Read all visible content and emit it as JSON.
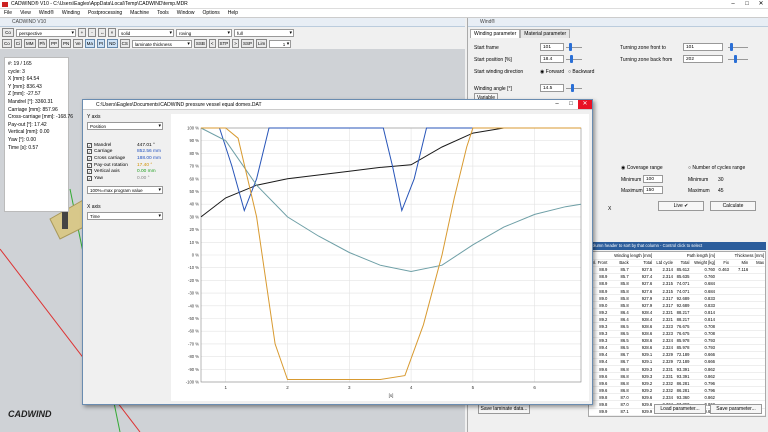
{
  "app": {
    "title": "CADWIND® V10  -  C:\\Users\\Eagles\\AppData\\Local\\Temp\\CADWIND\\temp.MDR"
  },
  "menu": [
    "File",
    "View",
    "Wind®",
    "Winding",
    "Postprocessing",
    "Machine",
    "Tools",
    "Window",
    "Options",
    "Help"
  ],
  "view3d": {
    "title": "CADWIND V10",
    "perspective": "perspective",
    "buttons1": [
      "Co",
      "Ci",
      "MM",
      "Ph",
      "PP",
      "PN",
      "Ve",
      "Ma",
      "PI",
      "ND",
      "CS"
    ],
    "solid": "solid",
    "roving": "roving",
    "full": "full",
    "laminate": "laminate thickness",
    "ssb": "SSB",
    "stp": "STP",
    "ssp": "SSP",
    "lim": "Lim",
    "value": "1"
  },
  "info": [
    "#: 19 / 165",
    "cycle: 3",
    "X [mm]: 64.54",
    "Y [mm]: 836.43",
    "Z [mm]: -27.57",
    "Mandrel [°]: 3360.31",
    "Carriage [mm]: 857.96",
    "Cross-carriage [mm]: -168.76",
    "Pay-out [°]: 17.42",
    "Vertical [mm]: 0.00",
    "Yaw [°]: 0.00",
    "Time [s]: 0.57"
  ],
  "dialog": {
    "title": "C:\\Users\\Eagles\\Documents\\CADWIND pressure vessel equal domes.DAT",
    "y_axis_label": "Y axis",
    "y_axis_select": "Position",
    "checks": [
      {
        "name": "Mandrel",
        "value": "447.01 °",
        "color": "#000000"
      },
      {
        "name": "Carriage",
        "value": "852.56 mm",
        "color": "#1f4fbf"
      },
      {
        "name": "Cross carriage",
        "value": "188.00 mm",
        "color": "#1f4fbf"
      },
      {
        "name": "Pay-out rotation",
        "value": "17.40 °",
        "color": "#d09000"
      },
      {
        "name": "Vertical axis",
        "value": "0.00 mm",
        "color": "#20a020"
      },
      {
        "name": "Yaw",
        "value": "0.00 °",
        "color": "#888888"
      }
    ],
    "range_select": "100%=max program value",
    "x_axis_label": "X axis",
    "x_axis_select": "Time"
  },
  "chart_data": {
    "type": "line",
    "xlabel": "[s]",
    "x_ticks": [
      1,
      2,
      3,
      4,
      5,
      6
    ],
    "y_ticks": [
      "100 %",
      "90 %",
      "80 %",
      "70 %",
      "60 %",
      "50 %",
      "40 %",
      "30 %",
      "20 %",
      "10 %",
      "0 %",
      "-10 %",
      "-20 %",
      "-30 %",
      "-40 %",
      "-50 %",
      "-60 %",
      "-70 %",
      "-80 %",
      "-90 %",
      "-100 %"
    ],
    "xlim": [
      0.6,
      6.75
    ],
    "ylim": [
      -100,
      100
    ],
    "series": [
      {
        "name": "Mandrel",
        "color": "#1a1a1a",
        "x": [
          0.6,
          1.0,
          1.5,
          2.0,
          2.5,
          3.0,
          3.5,
          4.0,
          4.5,
          5.0,
          5.5,
          6.0,
          6.5,
          6.75
        ],
        "y": [
          30,
          45,
          55,
          60,
          63,
          66,
          69,
          71,
          85,
          96,
          100,
          100,
          100,
          100
        ]
      },
      {
        "name": "Carriage",
        "color": "#2855b8",
        "x": [
          0.6,
          0.9,
          1.1,
          1.3,
          1.5,
          1.7,
          1.9,
          2.5,
          3.0,
          3.3,
          3.55,
          3.7,
          3.85,
          4.05,
          4.25,
          4.5,
          6.75
        ],
        "y": [
          100,
          100,
          70,
          35,
          60,
          100,
          100,
          100,
          100,
          100,
          100,
          70,
          35,
          60,
          100,
          100,
          100
        ]
      },
      {
        "name": "Cross carriage",
        "color": "#6e9fa6",
        "x": [
          0.6,
          1.0,
          1.5,
          2.0,
          2.5,
          3.0,
          3.5,
          4.0,
          4.5,
          5.0,
          5.5,
          6.0,
          6.5,
          6.75
        ],
        "y": [
          100,
          90,
          55,
          30,
          15,
          2,
          -8,
          -13,
          -8,
          8,
          22,
          32,
          38,
          40
        ]
      },
      {
        "name": "Pay-out rotation",
        "color": "#d89a30",
        "x": [
          0.6,
          1.0,
          1.2,
          1.5,
          1.8,
          2.0,
          2.5,
          3.0,
          3.5,
          3.9,
          4.2,
          4.5,
          4.7,
          4.9,
          5.0,
          6.0,
          6.75
        ],
        "y": [
          100,
          100,
          92,
          30,
          -70,
          -98,
          -98,
          -98,
          -98,
          -95,
          -55,
          0,
          45,
          85,
          100,
          100,
          100
        ]
      }
    ]
  },
  "right": {
    "title": "Wind®",
    "tabs": [
      "Winding parameter",
      "Material parameter"
    ],
    "start_frame_label": "Start frame",
    "start_frame": "101",
    "start_pos_label": "Start position [%]",
    "start_pos": "18.4",
    "start_dir_label": "Start winding direction",
    "forward": "Forward",
    "backward": "Backward",
    "tz_front_label": "Turning zone front to",
    "tz_front": "101",
    "tz_back_label": "Turning zone back from",
    "tz_back": "202",
    "wind_angle_label": "Winding angle [°]",
    "wind_angle": "14.5",
    "variable": "Variable",
    "coverage": "Coverage range",
    "cycles": "Number of cycles range",
    "minimum_label": "Minimum",
    "maximum_label": "Maximum",
    "cov_min": "100",
    "cov_max": "150",
    "cyc_min": "30",
    "cyc_max": "45",
    "x_mark": "X",
    "live": "Live ✔",
    "calculate": "Calculate",
    "table_hint": "column header to sort by that column - Control click to select",
    "table_headers_top": [
      "",
      "Winding length [mm]",
      "",
      "",
      "Path length [m]",
      "",
      "",
      "Thickness [mm]",
      ""
    ],
    "table_headers": [
      "nl. Front",
      "Back",
      "Total",
      "Ltd cycle",
      "Total",
      "Weight [kg]",
      "Fix",
      "Min",
      "Max"
    ],
    "rows": [
      [
        "88.9",
        "85.7",
        "927.5",
        "2.314",
        "85.612",
        "0.760",
        "0.463",
        "7.116",
        ""
      ],
      [
        "88.9",
        "85.7",
        "927.4",
        "2.314",
        "85.635",
        "0.760",
        "",
        "",
        ""
      ],
      [
        "88.9",
        "85.8",
        "927.6",
        "2.315",
        "74.071",
        "0.684",
        "",
        "",
        ""
      ],
      [
        "88.9",
        "85.8",
        "927.6",
        "2.315",
        "74.071",
        "0.684",
        "",
        "",
        ""
      ],
      [
        "89.0",
        "85.8",
        "927.9",
        "2.317",
        "92.689",
        "0.833",
        "",
        "",
        ""
      ],
      [
        "89.0",
        "85.8",
        "927.9",
        "2.317",
        "92.689",
        "0.833",
        "",
        "",
        ""
      ],
      [
        "89.2",
        "86.4",
        "928.4",
        "2.321",
        "88.217",
        "0.814",
        "",
        "",
        ""
      ],
      [
        "89.2",
        "86.4",
        "928.4",
        "2.321",
        "88.217",
        "0.814",
        "",
        "",
        ""
      ],
      [
        "89.3",
        "86.5",
        "928.6",
        "2.323",
        "76.675",
        "0.708",
        "",
        "",
        ""
      ],
      [
        "89.3",
        "86.5",
        "928.6",
        "2.323",
        "76.675",
        "0.708",
        "",
        "",
        ""
      ],
      [
        "89.3",
        "86.5",
        "928.6",
        "2.324",
        "85.978",
        "0.793",
        "",
        "",
        ""
      ],
      [
        "89.4",
        "86.5",
        "928.6",
        "2.324",
        "85.978",
        "0.793",
        "",
        "",
        ""
      ],
      [
        "89.4",
        "86.7",
        "929.1",
        "2.329",
        "72.189",
        "0.666",
        "",
        "",
        ""
      ],
      [
        "89.4",
        "86.7",
        "929.1",
        "2.329",
        "72.189",
        "0.666",
        "",
        "",
        ""
      ],
      [
        "89.6",
        "86.8",
        "929.3",
        "2.331",
        "93.391",
        "0.862",
        "",
        "",
        ""
      ],
      [
        "89.6",
        "86.8",
        "929.3",
        "2.331",
        "93.391",
        "0.862",
        "",
        "",
        ""
      ],
      [
        "89.6",
        "86.8",
        "929.2",
        "2.332",
        "86.281",
        "0.796",
        "",
        "",
        ""
      ],
      [
        "89.6",
        "86.8",
        "929.2",
        "2.332",
        "86.281",
        "0.796",
        "",
        "",
        ""
      ],
      [
        "89.8",
        "87.0",
        "929.6",
        "2.334",
        "93.360",
        "0.862",
        "",
        "",
        ""
      ],
      [
        "89.8",
        "87.0",
        "929.6",
        "2.334",
        "93.360",
        "0.862",
        "",
        "",
        ""
      ],
      [
        "89.9",
        "87.1",
        "929.9",
        "2.338",
        "72.467",
        "0.669",
        "",
        "",
        ""
      ]
    ],
    "save_laminate": "Save laminate data...",
    "load_param": "Load parameter...",
    "save_param": "Save parameter..."
  },
  "logo": "CADWIND"
}
